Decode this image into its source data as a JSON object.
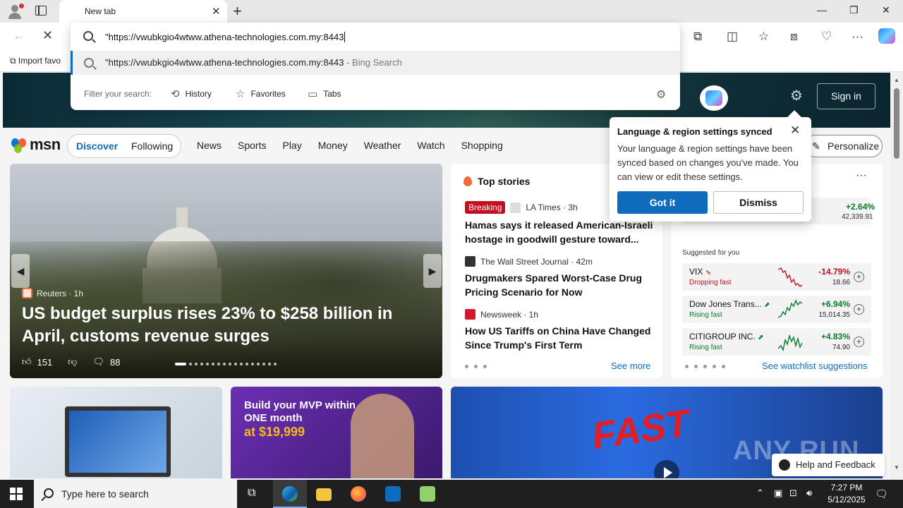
{
  "browser": {
    "tab_title": "New tab",
    "new_tab_symbol": "+",
    "close_symbol": "✕",
    "window_controls": {
      "minimize": "—",
      "restore": "❐",
      "close": "✕"
    },
    "favorites_bar": {
      "import_label": "Import favo"
    }
  },
  "omnibox": {
    "url_value": "\"https://vwubkgio4wtww.athena-technologies.com.my:8443",
    "suggestion_text": "\"https://vwubkgio4wtww.athena-technologies.com.my:8443",
    "suggestion_engine": " - Bing Search",
    "filter_label": "Filter your search:",
    "filters": {
      "history": "History",
      "favorites": "Favorites",
      "tabs": "Tabs"
    }
  },
  "msn": {
    "logo_text": "msn",
    "signin_label": "Sign in",
    "segment": {
      "discover": "Discover",
      "following": "Following"
    },
    "nav": [
      "News",
      "Sports",
      "Play",
      "Money",
      "Weather",
      "Watch",
      "Shopping"
    ],
    "personalize_label": "Personalize"
  },
  "hero": {
    "source": "Reuters · 1h",
    "headline": "US budget surplus rises 23% to $258 billion in April, customs revenue surges",
    "likes": "151",
    "comments": "88"
  },
  "top_stories": {
    "title": "Top stories",
    "stories": [
      {
        "badge": "Breaking",
        "publisher": "LA Times · 3h",
        "title": "Hamas says it released American-Israeli hostage in goodwill gesture toward..."
      },
      {
        "publisher": "The Wall Street Journal · 42m",
        "title": "Drugmakers Spared Worst-Case Drug Pricing Scenario for Now"
      },
      {
        "publisher": "Newsweek · 1h",
        "title": "How US Tariffs on China Have Changed Since Trump's First Term"
      }
    ],
    "see_more": "See more"
  },
  "watchlist": {
    "more": "···",
    "top_pct": "+2.64%",
    "top_value": "42,339.91",
    "suggested_label": "Suggested for you",
    "rows": [
      {
        "name": "VIX",
        "status": "Dropping fast",
        "pct": "-14.79%",
        "value": "18.66"
      },
      {
        "name": "Dow Jones Trans...",
        "status": "Rising fast",
        "pct": "+6.94%",
        "value": "15,014.35"
      },
      {
        "name": "CITIGROUP INC.",
        "status": "Rising fast",
        "pct": "+4.83%",
        "value": "74.90"
      }
    ],
    "suggestions_link": "See watchlist suggestions",
    "colors": {
      "up": "#0b7a2b",
      "down": "#c50f1f"
    }
  },
  "popup": {
    "title": "Language & region settings synced",
    "body": "Your language & region settings have been synced based on changes you've made. You can view or edit these settings.",
    "got_it": "Got it",
    "dismiss": "Dismiss"
  },
  "cards": {
    "ad_line1": "Build your MVP within",
    "ad_line2": "ONE month",
    "ad_line3": "at $19,999",
    "video_text": "FAST",
    "watermark": "ANY RUN"
  },
  "help": {
    "label": "Help and Feedback"
  },
  "taskbar": {
    "search_placeholder": "Type here to search",
    "time": "7:27 PM",
    "date": "5/12/2025"
  }
}
